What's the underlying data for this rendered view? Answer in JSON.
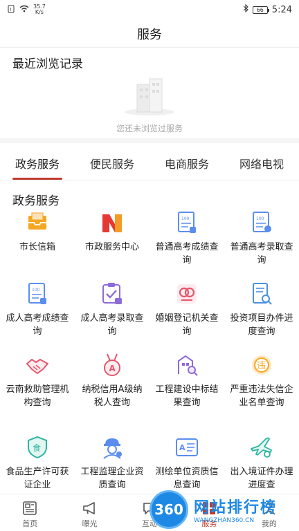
{
  "status_bar": {
    "speed_value": "35.7",
    "speed_unit": "K/s",
    "battery": "66",
    "time": "5:24"
  },
  "header": {
    "title": "服务"
  },
  "recent": {
    "title": "最近浏览记录",
    "empty_text": "您还未浏览过服务"
  },
  "tabs": [
    {
      "label": "政务服务",
      "active": true
    },
    {
      "label": "便民服务",
      "active": false
    },
    {
      "label": "电商服务",
      "active": false
    },
    {
      "label": "网络电视",
      "active": false
    }
  ],
  "gov_section": {
    "title": "政务服务"
  },
  "services": [
    {
      "label": "市长信箱",
      "icon": "mailbox-icon",
      "color": "#f5a623"
    },
    {
      "label": "市政服务中心",
      "icon": "municipal-logo-icon",
      "color": "#e53935"
    },
    {
      "label": "普通高考成绩查询",
      "icon": "score-card-icon",
      "color": "#5b8def"
    },
    {
      "label": "普通高考录取查询",
      "icon": "admission-doc-icon",
      "color": "#5b8def"
    },
    {
      "label": "成人高考成绩查询",
      "icon": "score-card-icon",
      "color": "#5b8def"
    },
    {
      "label": "成人高考录取查询",
      "icon": "clipboard-check-icon",
      "color": "#8e6bd8"
    },
    {
      "label": "婚姻登记机关查询",
      "icon": "marriage-icon",
      "color": "#e5566b"
    },
    {
      "label": "投资项目办件进度查询",
      "icon": "document-search-icon",
      "color": "#4a90e2"
    },
    {
      "label": "云南救助管理机构查询",
      "icon": "handshake-icon",
      "color": "#e5566b"
    },
    {
      "label": "纳税信用A级纳税人查询",
      "icon": "medal-icon",
      "color": "#e5566b"
    },
    {
      "label": "工程建设中标结果查询",
      "icon": "building-search-icon",
      "color": "#8e6bd8"
    },
    {
      "label": "严重违法失信企业名单查询",
      "icon": "violation-badge-icon",
      "color": "#f5a623"
    },
    {
      "label": "食品生产许可获证企业",
      "icon": "food-shield-icon",
      "color": "#2bb5a0"
    },
    {
      "label": "工程监理企业资质查询",
      "icon": "engineer-icon",
      "color": "#5b8def"
    },
    {
      "label": "测绘单位资质信息查询",
      "icon": "survey-card-icon",
      "color": "#5b8def"
    },
    {
      "label": "出入境证件办理进度查",
      "icon": "airplane-icon",
      "color": "#2bb5a0"
    }
  ],
  "bottom_nav": [
    {
      "label": "首页",
      "icon": "news-icon",
      "active": false
    },
    {
      "label": "曝光",
      "icon": "megaphone-icon",
      "active": false
    },
    {
      "label": "互动",
      "icon": "chat-icon",
      "active": false
    },
    {
      "label": "服务",
      "icon": "service-icon",
      "active": true
    },
    {
      "label": "我的",
      "icon": "user-icon",
      "active": false
    }
  ],
  "watermark": {
    "badge": "360",
    "title": "网站排行榜",
    "url": "WANGZHAN360.CN"
  },
  "colors": {
    "accent": "#c0392b",
    "muted": "#aaaaaa"
  }
}
